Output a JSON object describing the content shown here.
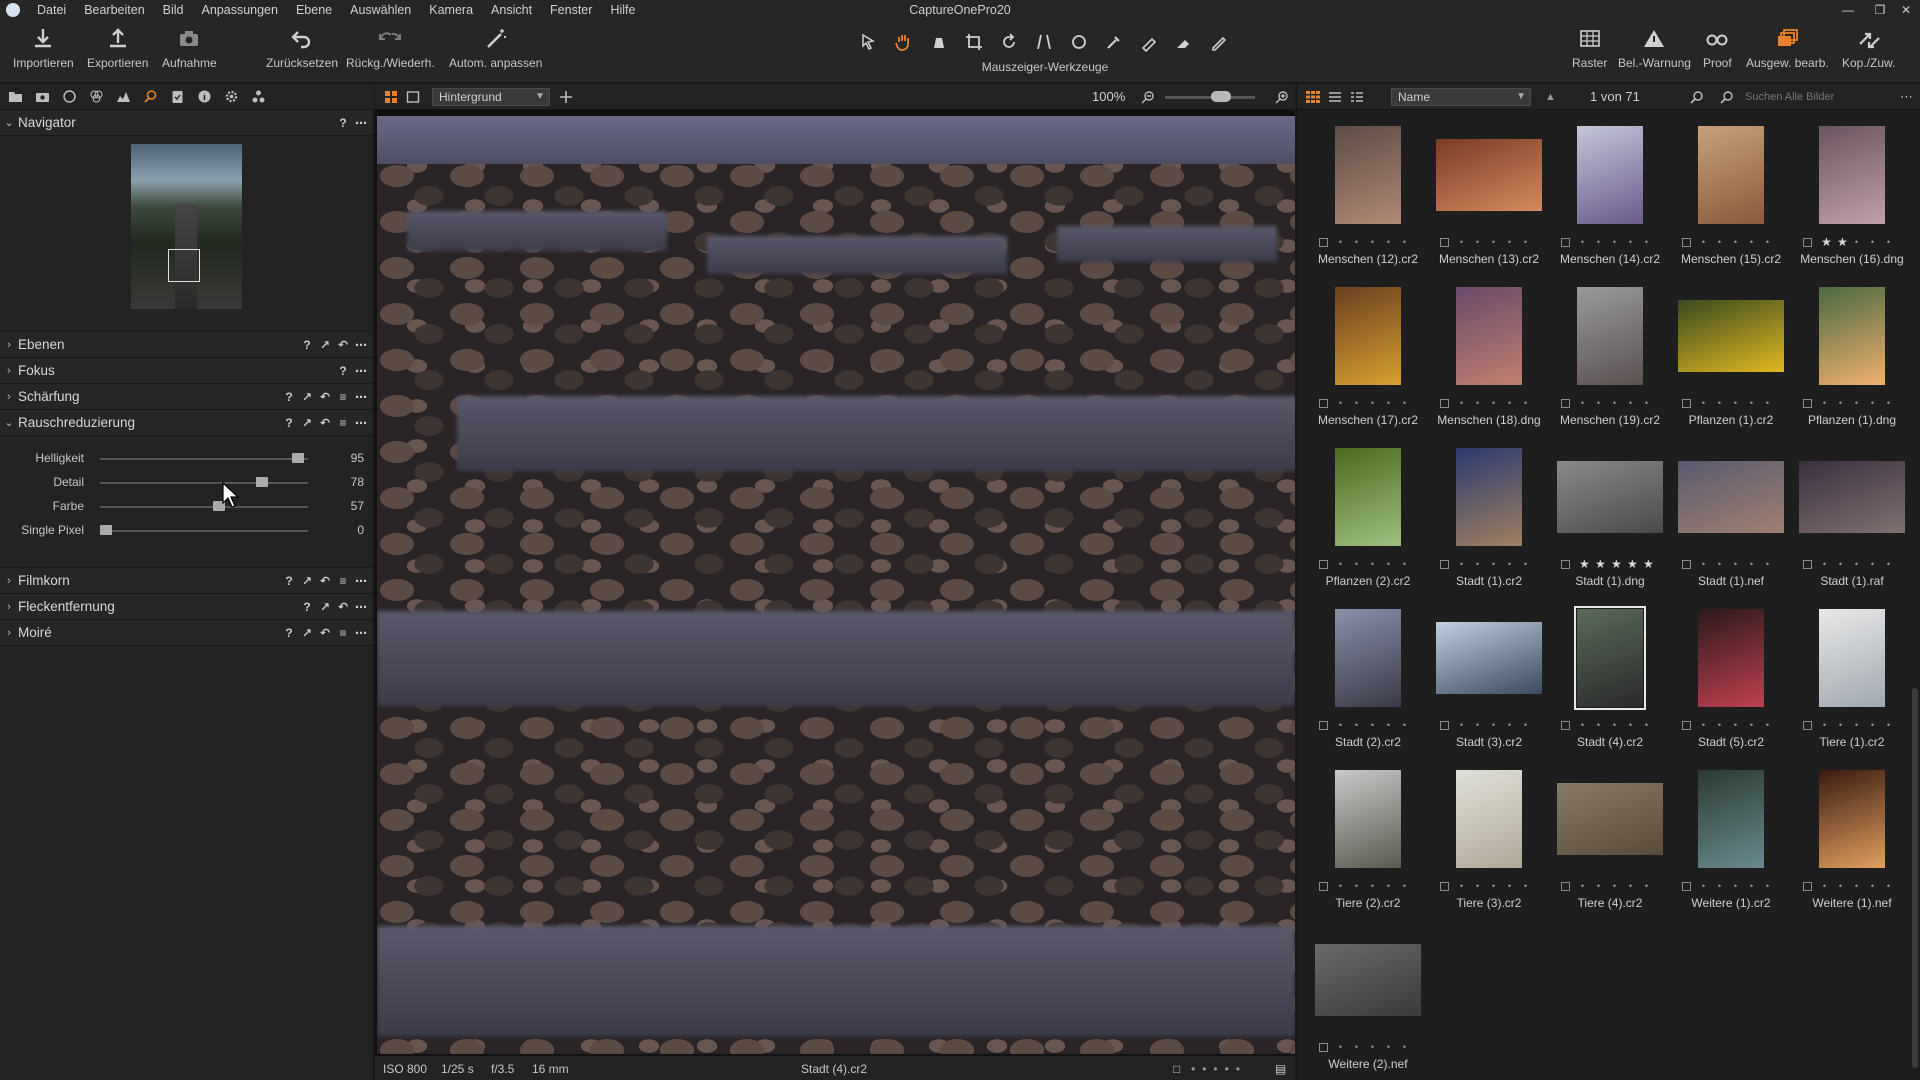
{
  "window": {
    "title": "CaptureOnePro20",
    "menu": [
      "Datei",
      "Bearbeiten",
      "Bild",
      "Anpassungen",
      "Ebene",
      "Auswählen",
      "Kamera",
      "Ansicht",
      "Fenster",
      "Hilfe"
    ]
  },
  "toolbar": {
    "left": [
      {
        "label": "Importieren",
        "icon": "import-icon"
      },
      {
        "label": "Exportieren",
        "icon": "export-icon"
      },
      {
        "label": "Aufnahme",
        "icon": "camera-icon"
      },
      {
        "label": "Zurücksetzen",
        "icon": "reset-icon"
      },
      {
        "label": "Rückg./Wiederh.",
        "icon": "undo-redo-icon"
      },
      {
        "label": "Autom. anpassen",
        "icon": "magic-wand-icon"
      }
    ],
    "cursor_tools_label": "Mauszeiger-Werkzeuge",
    "right": [
      {
        "label": "Raster",
        "icon": "grid-icon"
      },
      {
        "label": "Bel.-Warnung",
        "icon": "warning-icon"
      },
      {
        "label": "Proof",
        "icon": "glasses-icon"
      },
      {
        "label": "Ausgew. bearb.",
        "icon": "edit-selected-icon"
      },
      {
        "label": "Kop./Zuw.",
        "icon": "copy-apply-icon"
      }
    ]
  },
  "left_panel": {
    "navigator": {
      "title": "Navigator"
    },
    "sections": [
      {
        "title": "Ebenen",
        "expanded": false
      },
      {
        "title": "Fokus",
        "expanded": false
      },
      {
        "title": "Schärfung",
        "expanded": false
      },
      {
        "title": "Rauschreduzierung",
        "expanded": true
      },
      {
        "title": "Filmkorn",
        "expanded": false
      },
      {
        "title": "Fleckentfernung",
        "expanded": false
      },
      {
        "title": "Moiré",
        "expanded": false
      }
    ],
    "noise_reduction": {
      "sliders": [
        {
          "label": "Helligkeit",
          "value": "95",
          "pos": 0.95
        },
        {
          "label": "Detail",
          "value": "78",
          "pos": 0.78
        },
        {
          "label": "Farbe",
          "value": "57",
          "pos": 0.57
        },
        {
          "label": "Single Pixel",
          "value": "0",
          "pos": 0.0
        }
      ]
    }
  },
  "viewer": {
    "layer": "Hintergrund",
    "zoom": "100%",
    "footer": {
      "iso": "ISO 800",
      "shutter": "1/25 s",
      "aperture": "f/3.5",
      "focal": "16 mm",
      "filename": "Stadt (4).cr2"
    }
  },
  "browser": {
    "sort": "Name",
    "count": "1 von 71",
    "search_placeholder": "Suchen Alle Bilder",
    "images": [
      {
        "name": "Menschen (12).cr2",
        "stars": 0,
        "orient": "portrait",
        "colors": [
          "#5d4c45",
          "#b08a75"
        ]
      },
      {
        "name": "Menschen (13).cr2",
        "stars": 0,
        "orient": "landscape",
        "colors": [
          "#7a3c25",
          "#d48a60"
        ]
      },
      {
        "name": "Menschen (14).cr2",
        "stars": 0,
        "orient": "portrait",
        "colors": [
          "#c4c6d8",
          "#6a5a8a"
        ]
      },
      {
        "name": "Menschen (15).cr2",
        "stars": 0,
        "orient": "portrait",
        "colors": [
          "#c9a07a",
          "#8a5a3a"
        ]
      },
      {
        "name": "Menschen (16).dng",
        "stars": 2,
        "orient": "portrait",
        "colors": [
          "#6a5560",
          "#c0a0a8"
        ]
      },
      {
        "name": "Menschen (17).cr2",
        "stars": 0,
        "orient": "portrait",
        "colors": [
          "#6a4020",
          "#d8a030"
        ]
      },
      {
        "name": "Menschen (18).dng",
        "stars": 0,
        "orient": "portrait",
        "colors": [
          "#6a4a6a",
          "#c08070"
        ]
      },
      {
        "name": "Menschen (19).cr2",
        "stars": 0,
        "orient": "portrait",
        "colors": [
          "#9a9a9a",
          "#5a5050"
        ]
      },
      {
        "name": "Pflanzen (1).cr2",
        "stars": 0,
        "orient": "landscape",
        "colors": [
          "#3a4a20",
          "#e0b820"
        ]
      },
      {
        "name": "Pflanzen (1).dng",
        "stars": 0,
        "orient": "portrait",
        "colors": [
          "#4a6a40",
          "#f0b070"
        ]
      },
      {
        "name": "Pflanzen (2).cr2",
        "stars": 0,
        "orient": "portrait",
        "colors": [
          "#4a6a20",
          "#a0c080"
        ]
      },
      {
        "name": "Stadt (1).cr2",
        "stars": 0,
        "orient": "portrait",
        "colors": [
          "#2a3a70",
          "#a08060"
        ]
      },
      {
        "name": "Stadt (1).dng",
        "stars": 5,
        "orient": "landscape",
        "colors": [
          "#8a8a8a",
          "#4a4a4a"
        ]
      },
      {
        "name": "Stadt (1).nef",
        "stars": 0,
        "orient": "landscape",
        "colors": [
          "#5a5a70",
          "#a08070"
        ]
      },
      {
        "name": "Stadt (1).raf",
        "stars": 0,
        "orient": "landscape",
        "colors": [
          "#3a3040",
          "#807070"
        ]
      },
      {
        "name": "Stadt (2).cr2",
        "stars": 0,
        "orient": "portrait",
        "colors": [
          "#8a90a8",
          "#3a3a48"
        ]
      },
      {
        "name": "Stadt (3).cr2",
        "stars": 0,
        "orient": "landscape",
        "colors": [
          "#c0d0e0",
          "#3a4a60"
        ]
      },
      {
        "name": "Stadt (4).cr2",
        "stars": 0,
        "orient": "portrait",
        "colors": [
          "#5a6a5a",
          "#2a2a2a"
        ],
        "selected": true
      },
      {
        "name": "Stadt (5).cr2",
        "stars": 0,
        "orient": "portrait",
        "colors": [
          "#2a1a1a",
          "#c04050"
        ]
      },
      {
        "name": "Tiere (1).cr2",
        "stars": 0,
        "orient": "portrait",
        "colors": [
          "#e8e8e8",
          "#a0a8b0"
        ]
      },
      {
        "name": "Tiere (2).cr2",
        "stars": 0,
        "orient": "portrait",
        "colors": [
          "#c8c8c8",
          "#5a5a50"
        ]
      },
      {
        "name": "Tiere (3).cr2",
        "stars": 0,
        "orient": "portrait",
        "colors": [
          "#e0e0d8",
          "#b0a898"
        ]
      },
      {
        "name": "Tiere (4).cr2",
        "stars": 0,
        "orient": "landscape",
        "colors": [
          "#8a7a6a",
          "#5a4a3a"
        ]
      },
      {
        "name": "Weitere (1).cr2",
        "stars": 0,
        "orient": "portrait",
        "colors": [
          "#2a3a30",
          "#6a8a90"
        ]
      },
      {
        "name": "Weitere (1).nef",
        "stars": 0,
        "orient": "portrait",
        "colors": [
          "#3a1a10",
          "#e0a060"
        ]
      },
      {
        "name": "Weitere (2).nef",
        "stars": 0,
        "orient": "landscape",
        "colors": [
          "#6a6a6a",
          "#3a3a3a"
        ]
      }
    ]
  }
}
